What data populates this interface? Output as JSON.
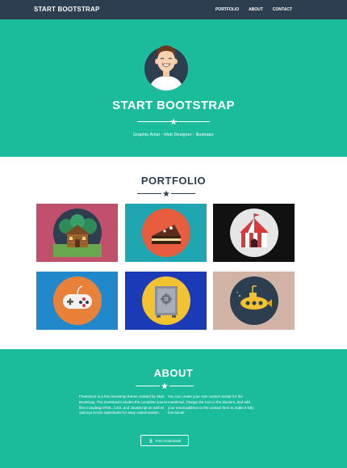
{
  "navbar": {
    "brand": "START BOOTSTRAP",
    "links": [
      "PORTFOLIO",
      "ABOUT",
      "CONTACT"
    ]
  },
  "masthead": {
    "title": "START BOOTSTRAP",
    "subtitle": "Graphic Artist - Web Designer - Illustrator",
    "avatar_icon": "avatar-illustration"
  },
  "portfolio": {
    "title": "PORTFOLIO",
    "items": [
      {
        "name": "cabin",
        "bg": "#c0506b"
      },
      {
        "name": "cake",
        "bg": "#1fa6b0"
      },
      {
        "name": "circus",
        "bg": "#111111"
      },
      {
        "name": "game",
        "bg": "#2188cc"
      },
      {
        "name": "safe",
        "bg": "#1a3ab8"
      },
      {
        "name": "submarine",
        "bg": "#d2b4a6"
      }
    ]
  },
  "about": {
    "title": "ABOUT",
    "left_text": "Freelancer is a free bootstrap theme created by Start Bootstrap. The download includes the complete source files including HTML, CSS, and JavaScript as well as optional SASS stylesheets for easy customization.",
    "right_text": "You can create your own custom avatar for the masthead, change the icon in the dividers, and add your email address to the contact form to make it fully functional!",
    "button_label": "Free Download!",
    "button_icon": "download-icon"
  },
  "colors": {
    "primary": "#1abc9c",
    "secondary": "#2c3e50"
  }
}
